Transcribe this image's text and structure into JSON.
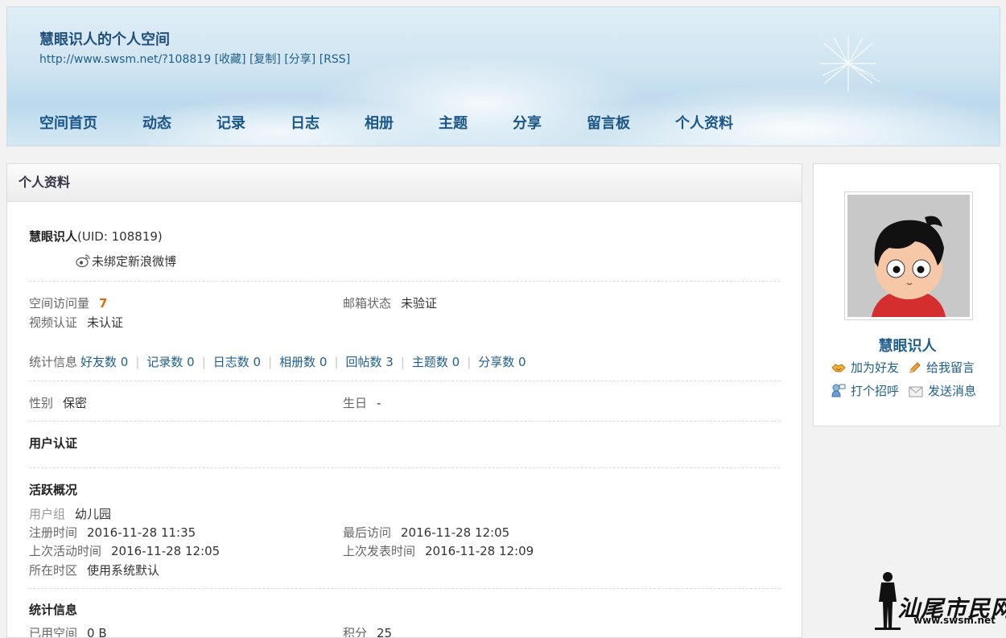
{
  "header": {
    "title": "慧眼识人的个人空间",
    "url": "http://www.swsm.net/?108819",
    "links": [
      "[收藏]",
      "[复制]",
      "[分享]",
      "[RSS]"
    ],
    "nav": [
      "空间首页",
      "动态",
      "记录",
      "日志",
      "相册",
      "主题",
      "分享",
      "留言板",
      "个人资料"
    ]
  },
  "panel": {
    "heading": "个人资料",
    "username": "慧眼识人",
    "uid": "(UID: 108819)",
    "weibo": "未绑定新浪微博",
    "visits_label": "空间访问量",
    "visits_value": "7",
    "email_label": "邮箱状态",
    "email_value": "未验证",
    "video_label": "视频认证",
    "video_value": "未认证",
    "stats_label": "统计信息",
    "stats": [
      "好友数 0",
      "记录数 0",
      "日志数 0",
      "相册数 0",
      "回帖数 3",
      "主题数 0",
      "分享数 0"
    ],
    "gender_label": "性别",
    "gender_value": "保密",
    "birthday_label": "生日",
    "birthday_value": "-",
    "cert_heading": "用户认证",
    "active_heading": "活跃概况",
    "group_label": "用户组",
    "group_value": "幼儿园",
    "reg_label": "注册时间",
    "reg_value": "2016-11-28 11:35",
    "lastvisit_label": "最后访问",
    "lastvisit_value": "2016-11-28 12:05",
    "lastactive_label": "上次活动时间",
    "lastactive_value": "2016-11-28 12:05",
    "lastpost_label": "上次发表时间",
    "lastpost_value": "2016-11-28 12:09",
    "tz_label": "所在时区",
    "tz_value": "使用系统默认",
    "stats_heading": "统计信息",
    "space_label": "已用空间",
    "space_value": "0 B",
    "points_label": "积分",
    "points_value": "25"
  },
  "sidebar": {
    "name": "慧眼识人",
    "add_friend": "加为好友",
    "leave_msg": "给我留言",
    "greet": "打个招呼",
    "send_msg": "发送消息"
  },
  "watermark": {
    "text": "汕尾市民网",
    "url": "www.swsm.net"
  }
}
